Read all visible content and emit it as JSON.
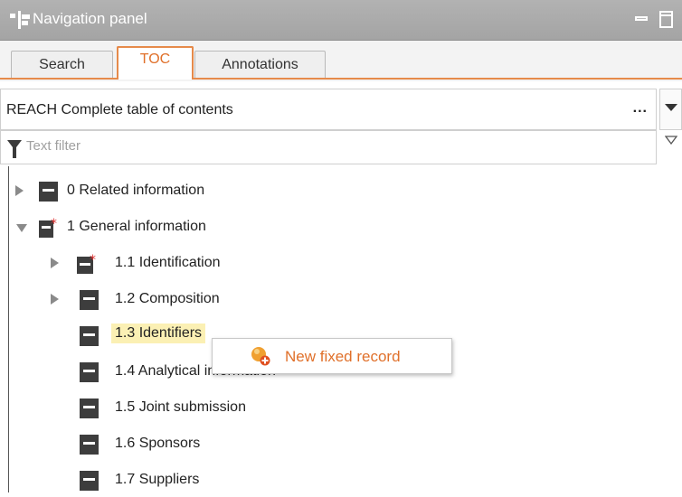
{
  "panel": {
    "title": "Navigation panel"
  },
  "tabs": [
    {
      "label": "Search"
    },
    {
      "label": "TOC"
    },
    {
      "label": "Annotations"
    }
  ],
  "selector": {
    "value": "REACH Complete table of contents",
    "more": "..."
  },
  "filter": {
    "placeholder": "Text filter"
  },
  "tree": [
    {
      "label": "0 Related information",
      "expander": "collapsed",
      "icon": "document-icon"
    },
    {
      "label": "1 General information",
      "expander": "expanded",
      "icon": "document-required-icon"
    },
    {
      "label": "1.1 Identification",
      "expander": "collapsed",
      "icon": "document-required-icon"
    },
    {
      "label": "1.2 Composition",
      "expander": "collapsed",
      "icon": "document-icon"
    },
    {
      "label": "1.3 Identifiers",
      "expander": "none",
      "icon": "document-icon",
      "highlighted": true
    },
    {
      "label": "1.4 Analytical information",
      "expander": "none",
      "icon": "document-icon"
    },
    {
      "label": "1.5 Joint submission",
      "expander": "none",
      "icon": "document-icon"
    },
    {
      "label": "1.6 Sponsors",
      "expander": "none",
      "icon": "document-icon"
    },
    {
      "label": "1.7 Suppliers",
      "expander": "none",
      "icon": "document-icon"
    }
  ],
  "context_menu": {
    "item": "New fixed record",
    "icon": "new-record-icon"
  },
  "colors": {
    "accent": "#e0702a",
    "highlight": "#fbf0b4",
    "titlebar": "#aaaaaa"
  }
}
